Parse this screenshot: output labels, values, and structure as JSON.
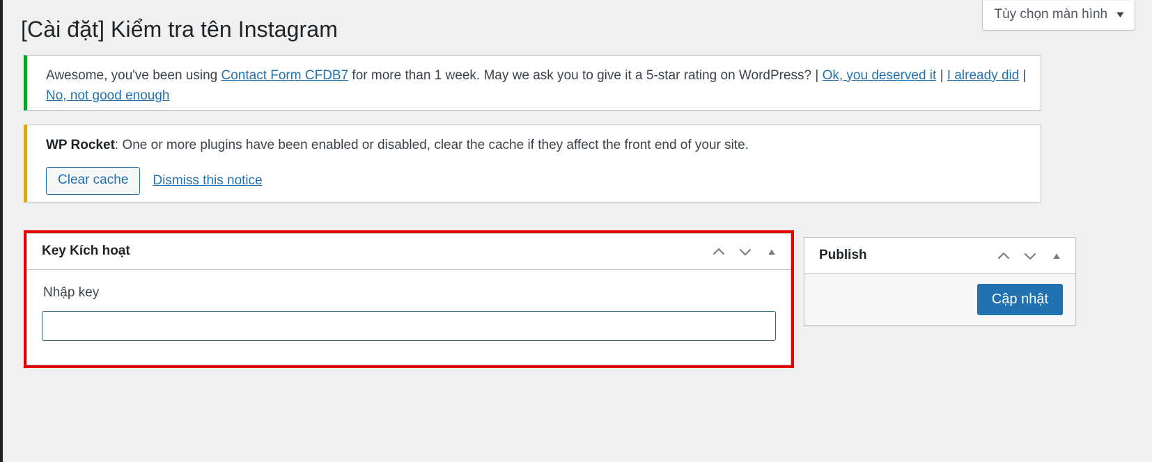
{
  "header": {
    "screen_options_label": "Tùy chọn màn hình",
    "screen_options_caret": "▼",
    "page_title": "[Cài đặt] Kiểm tra tên Instagram"
  },
  "notices": {
    "cfdb7": {
      "accent_color": "#00a32a",
      "text_before_link": "Awesome, you've been using ",
      "plugin_link": "Contact Form CFDB7",
      "text_after_link": " for more than 1 week. May we ask you to give it a 5-star rating on WordPress? | ",
      "link_ok": "Ok, you deserved it",
      "sep1": " | ",
      "link_already": "I already did",
      "sep2": " | ",
      "link_no": "No, not good enough"
    },
    "wp_rocket": {
      "accent_color": "#dba617",
      "title": "WP Rocket",
      "message": ": One or more plugins have been enabled or disabled, clear the cache if they affect the front end of your site.",
      "clear_cache_label": "Clear cache",
      "dismiss_label": "Dismiss this notice"
    }
  },
  "main_box": {
    "highlight_color": "#e60000",
    "title": "Key Kích hoạt",
    "field_label": "Nhập key",
    "input_value": "",
    "input_placeholder": "",
    "move_up_icon": "chevron-up",
    "move_down_icon": "chevron-down",
    "toggle_icon": "▲"
  },
  "publish_box": {
    "title": "Publish",
    "move_up_icon": "chevron-up",
    "move_down_icon": "chevron-down",
    "toggle_icon": "▲",
    "update_button_label": "Cập nhật",
    "primary_color": "#2271b1"
  }
}
